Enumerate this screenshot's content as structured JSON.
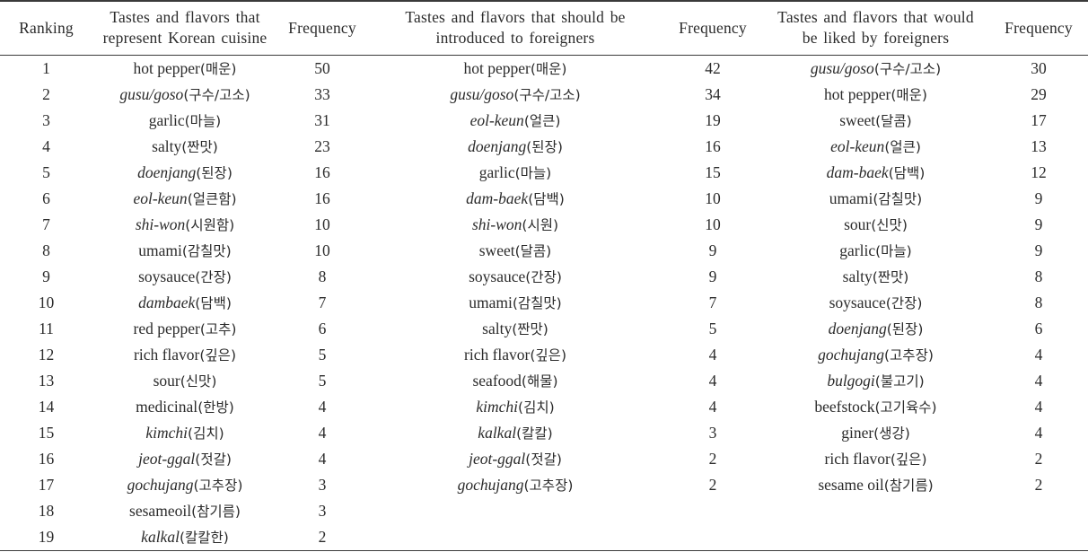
{
  "table": {
    "headers": {
      "ranking": "Ranking",
      "col1_title": "Tastes and flavors that represent Korean cuisine",
      "freq1": "Frequency",
      "col2_title": "Tastes and flavors that should be introduced to foreigners",
      "freq2": "Frequency",
      "col3_title": "Tastes and flavors that would be liked by foreigners",
      "freq3": "Frequency"
    },
    "rows": [
      {
        "rank": "1",
        "c1_term": "hot pepper",
        "c1_ko": "(매운)",
        "c1_italic": false,
        "c1_freq": "50",
        "c2_term": "hot pepper",
        "c2_ko": "(매운)",
        "c2_italic": false,
        "c2_freq": "42",
        "c3_term": "gusu/goso",
        "c3_ko": "(구수/고소)",
        "c3_italic": true,
        "c3_freq": "30"
      },
      {
        "rank": "2",
        "c1_term": "gusu/goso",
        "c1_ko": "(구수/고소)",
        "c1_italic": true,
        "c1_freq": "33",
        "c2_term": "gusu/goso",
        "c2_ko": "(구수/고소)",
        "c2_italic": true,
        "c2_freq": "34",
        "c3_term": "hot pepper",
        "c3_ko": "(매운)",
        "c3_italic": false,
        "c3_freq": "29"
      },
      {
        "rank": "3",
        "c1_term": "garlic",
        "c1_ko": "(마늘)",
        "c1_italic": false,
        "c1_freq": "31",
        "c2_term": "eol-keun",
        "c2_ko": "(얼큰)",
        "c2_italic": true,
        "c2_freq": "19",
        "c3_term": "sweet",
        "c3_ko": "(달콤)",
        "c3_italic": false,
        "c3_freq": "17"
      },
      {
        "rank": "4",
        "c1_term": "salty",
        "c1_ko": "(짠맛)",
        "c1_italic": false,
        "c1_freq": "23",
        "c2_term": "doenjang",
        "c2_ko": "(된장)",
        "c2_italic": true,
        "c2_freq": "16",
        "c3_term": "eol-keun",
        "c3_ko": "(얼큰)",
        "c3_italic": true,
        "c3_freq": "13"
      },
      {
        "rank": "5",
        "c1_term": "doenjang",
        "c1_ko": "(된장)",
        "c1_italic": true,
        "c1_freq": "16",
        "c2_term": "garlic",
        "c2_ko": "(마늘)",
        "c2_italic": false,
        "c2_freq": "15",
        "c3_term": "dam-baek",
        "c3_ko": "(담백)",
        "c3_italic": true,
        "c3_freq": "12"
      },
      {
        "rank": "6",
        "c1_term": "eol-keun",
        "c1_ko": "(얼큰함)",
        "c1_italic": true,
        "c1_freq": "16",
        "c2_term": "dam-baek",
        "c2_ko": "(담백)",
        "c2_italic": true,
        "c2_freq": "10",
        "c3_term": "umami",
        "c3_ko": "(감칠맛)",
        "c3_italic": false,
        "c3_freq": "9"
      },
      {
        "rank": "7",
        "c1_term": "shi-won",
        "c1_ko": "(시원함)",
        "c1_italic": true,
        "c1_freq": "10",
        "c2_term": "shi-won",
        "c2_ko": "(시원)",
        "c2_italic": true,
        "c2_freq": "10",
        "c3_term": "sour",
        "c3_ko": "(신맛)",
        "c3_italic": false,
        "c3_freq": "9"
      },
      {
        "rank": "8",
        "c1_term": "umami",
        "c1_ko": "(감칠맛)",
        "c1_italic": false,
        "c1_freq": "10",
        "c2_term": "sweet",
        "c2_ko": "(달콤)",
        "c2_italic": false,
        "c2_freq": "9",
        "c3_term": "garlic",
        "c3_ko": "(마늘)",
        "c3_italic": false,
        "c3_freq": "9"
      },
      {
        "rank": "9",
        "c1_term": "soysauce",
        "c1_ko": "(간장)",
        "c1_italic": false,
        "c1_freq": "8",
        "c2_term": "soysauce",
        "c2_ko": "(간장)",
        "c2_italic": false,
        "c2_freq": "9",
        "c3_term": "salty",
        "c3_ko": "(짠맛)",
        "c3_italic": false,
        "c3_freq": "8"
      },
      {
        "rank": "10",
        "c1_term": "dambaek",
        "c1_ko": "(담백)",
        "c1_italic": true,
        "c1_freq": "7",
        "c2_term": "umami",
        "c2_ko": "(감칠맛)",
        "c2_italic": false,
        "c2_freq": "7",
        "c3_term": "soysauce",
        "c3_ko": "(간장)",
        "c3_italic": false,
        "c3_freq": "8"
      },
      {
        "rank": "11",
        "c1_term": "red pepper",
        "c1_ko": "(고추)",
        "c1_italic": false,
        "c1_freq": "6",
        "c2_term": "salty",
        "c2_ko": "(짠맛)",
        "c2_italic": false,
        "c2_freq": "5",
        "c3_term": "doenjang",
        "c3_ko": "(된장)",
        "c3_italic": true,
        "c3_freq": "6"
      },
      {
        "rank": "12",
        "c1_term": "rich flavor",
        "c1_ko": "(깊은)",
        "c1_italic": false,
        "c1_freq": "5",
        "c2_term": "rich flavor",
        "c2_ko": "(깊은)",
        "c2_italic": false,
        "c2_freq": "4",
        "c3_term": "gochujang",
        "c3_ko": "(고추장)",
        "c3_italic": true,
        "c3_freq": "4"
      },
      {
        "rank": "13",
        "c1_term": "sour",
        "c1_ko": "(신맛)",
        "c1_italic": false,
        "c1_freq": "5",
        "c2_term": "seafood",
        "c2_ko": "(해물)",
        "c2_italic": false,
        "c2_freq": "4",
        "c3_term": "bulgogi",
        "c3_ko": "(불고기)",
        "c3_italic": true,
        "c3_freq": "4"
      },
      {
        "rank": "14",
        "c1_term": "medicinal",
        "c1_ko": "(한방)",
        "c1_italic": false,
        "c1_freq": "4",
        "c2_term": "kimchi",
        "c2_ko": "(김치)",
        "c2_italic": true,
        "c2_freq": "4",
        "c3_term": "beefstock",
        "c3_ko": "(고기육수)",
        "c3_italic": false,
        "c3_freq": "4"
      },
      {
        "rank": "15",
        "c1_term": "kimchi",
        "c1_ko": "(김치)",
        "c1_italic": true,
        "c1_freq": "4",
        "c2_term": "kalkal",
        "c2_ko": "(칼칼)",
        "c2_italic": true,
        "c2_freq": "3",
        "c3_term": "giner",
        "c3_ko": "(생강)",
        "c3_italic": false,
        "c3_freq": "4"
      },
      {
        "rank": "16",
        "c1_term": "jeot-ggal",
        "c1_ko": "(젓갈)",
        "c1_italic": true,
        "c1_freq": "4",
        "c2_term": "jeot-ggal",
        "c2_ko": "(젓갈)",
        "c2_italic": true,
        "c2_freq": "2",
        "c3_term": "rich flavor",
        "c3_ko": "(깊은)",
        "c3_italic": false,
        "c3_freq": "2"
      },
      {
        "rank": "17",
        "c1_term": "gochujang",
        "c1_ko": "(고추장)",
        "c1_italic": true,
        "c1_freq": "3",
        "c2_term": "gochujang",
        "c2_ko": "(고추장)",
        "c2_italic": true,
        "c2_freq": "2",
        "c3_term": "sesame oil",
        "c3_ko": "(참기름)",
        "c3_italic": false,
        "c3_freq": "2"
      },
      {
        "rank": "18",
        "c1_term": "sesameoil",
        "c1_ko": "(참기름)",
        "c1_italic": false,
        "c1_freq": "3",
        "c2_term": "",
        "c2_ko": "",
        "c2_italic": false,
        "c2_freq": "",
        "c3_term": "",
        "c3_ko": "",
        "c3_italic": false,
        "c3_freq": ""
      },
      {
        "rank": "19",
        "c1_term": "kalkal",
        "c1_ko": "(칼칼한)",
        "c1_italic": true,
        "c1_freq": "2",
        "c2_term": "",
        "c2_ko": "",
        "c2_italic": false,
        "c2_freq": "",
        "c3_term": "",
        "c3_ko": "",
        "c3_italic": false,
        "c3_freq": ""
      }
    ]
  }
}
